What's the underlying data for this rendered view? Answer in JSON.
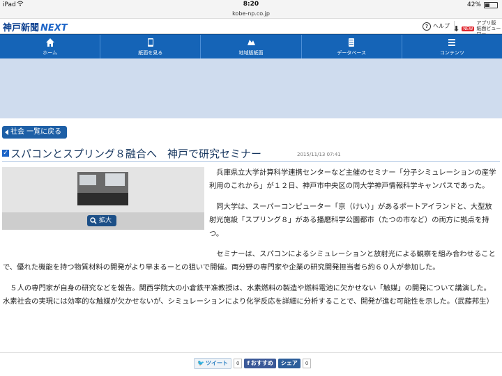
{
  "status": {
    "device": "iPad",
    "time": "8:20",
    "battery": "42%"
  },
  "url": "kobe-np.co.jp",
  "header": {
    "logo_main": "神戸新聞",
    "logo_next": "NEXT",
    "help_label": "ヘルプ",
    "app_new": "NEW",
    "app_label_1": "アプリ版",
    "app_label_2": "紙面ビューワー"
  },
  "nav": {
    "items": [
      {
        "label": "ホーム",
        "icon": "home-icon"
      },
      {
        "label": "紙面を見る",
        "icon": "tablet-icon"
      },
      {
        "label": "地域版紙面",
        "icon": "map-icon"
      },
      {
        "label": "データベース",
        "icon": "database-icon"
      },
      {
        "label": "コンテンツ",
        "icon": "menu-icon"
      }
    ]
  },
  "back_label": "社会 一覧に戻る",
  "article": {
    "title": "スパコンとスプリング８融合へ　神戸で研究セミナー",
    "date": "2015/11/13 07:41",
    "zoom_label": "拡大",
    "paragraphs": [
      "兵庫県立大学計算科学連携センターなど主催のセミナー「分子シミュレーションの産学利用のこれから」が１２日、神戸市中央区の同大学神戸情報科学キャンパスであった。",
      "同大学は、スーパーコンピューター「京（けい）」があるポートアイランドと、大型放射光施設「スプリング８」がある播磨科学公園都市（たつの市など）の両方に拠点を持つ。",
      "セミナーは、スパコンによるシミュレーションと放射光による観察を組み合わせることで、優れた機能を持つ物質材料の開発がより早まるーとの狙いで開催。両分野の専門家や企業の研究開発担当者ら約６０人が参加した。",
      "５人の専門家が自身の研究などを報告。関西学院大の小倉鉄平准教授は、水素燃料の製造や燃料電池に欠かせない「触媒」の開発について講演した。水素社会の実現には効率的な触媒が欠かせないが、シミュレーションにより化学反応を詳細に分析することで、開発が進む可能性を示した。（武藤邦生）"
    ]
  },
  "social": {
    "tweet": "ツイート",
    "tweet_count": "0",
    "fb": "おすすめ",
    "share": "シェア",
    "share_count": "0"
  }
}
